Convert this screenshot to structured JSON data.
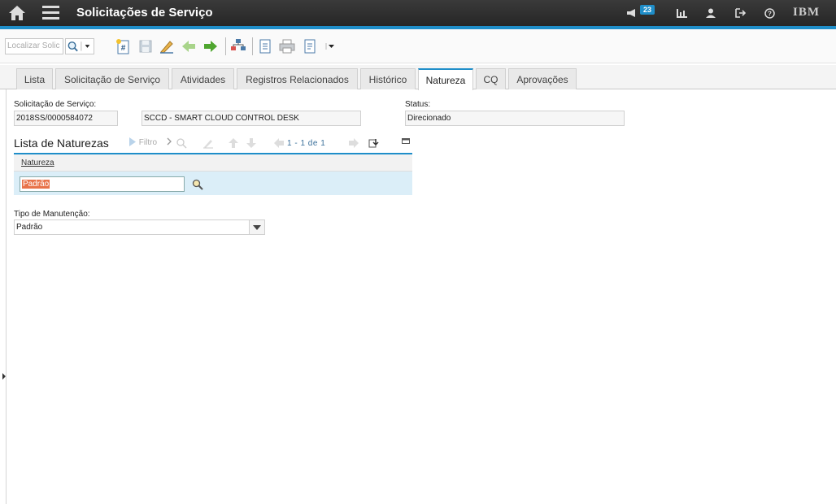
{
  "header": {
    "title": "Solicitações de Serviço",
    "notification_count": "23",
    "brand": "IBM"
  },
  "toolbar": {
    "quick_search_placeholder": "Localizar Solic"
  },
  "tabs": [
    {
      "label": "Lista"
    },
    {
      "label": "Solicitação de Serviço"
    },
    {
      "label": "Atividades"
    },
    {
      "label": "Registros Relacionados"
    },
    {
      "label": "Histórico"
    },
    {
      "label": "Natureza",
      "active": true
    },
    {
      "label": "CQ"
    },
    {
      "label": "Aprovações"
    }
  ],
  "form": {
    "request_label": "Solicitação de Serviço:",
    "request_id": "2018SS/0000584072",
    "request_description": "SCCD - SMART CLOUD CONTROL DESK",
    "status_label": "Status:",
    "status_value": "Direcionado"
  },
  "natures": {
    "title": "Lista de Naturezas",
    "filter_label": "Filtro",
    "pager": "1 - 1 de 1",
    "column_header": "Natureza",
    "rows": [
      {
        "natureza": "Padrão"
      }
    ]
  },
  "maintenance": {
    "label": "Tipo de Manutenção:",
    "value": "Padrão"
  },
  "colors": {
    "accent": "#1f8ec9",
    "topbar": "#2e2e2e",
    "selected_row": "#dbeef8",
    "selection_highlight": "#e8734a"
  }
}
